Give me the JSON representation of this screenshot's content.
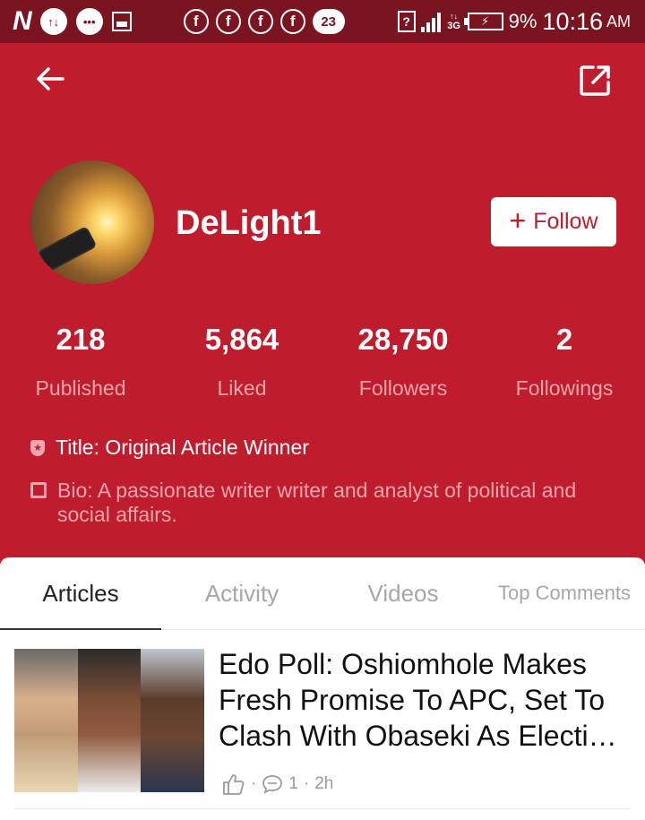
{
  "status_bar": {
    "carrier_letter": "N",
    "notification_badge_count": "23",
    "network_type": "3G",
    "battery_percent": "9%",
    "time": "10:16",
    "ampm": "AM"
  },
  "profile": {
    "username": "DeLight1",
    "follow_label": "Follow",
    "stats": [
      {
        "value": "218",
        "label": "Published"
      },
      {
        "value": "5,864",
        "label": "Liked"
      },
      {
        "value": "28,750",
        "label": "Followers"
      },
      {
        "value": "2",
        "label": "Followings"
      }
    ],
    "title": "Title: Original Article Winner",
    "bio": "Bio: A passionate writer writer and analyst of political and social affairs."
  },
  "tabs": [
    {
      "label": "Articles",
      "active": true
    },
    {
      "label": "Activity",
      "active": false
    },
    {
      "label": "Videos",
      "active": false
    },
    {
      "label": "Top Comments",
      "active": false
    }
  ],
  "articles": [
    {
      "title": "Edo Poll: Oshiomhole Makes Fresh Promise To APC, Set To Clash With Obaseki As Electi…",
      "comment_count": "1",
      "age": "2h"
    }
  ],
  "colors": {
    "status_bar": "#7a1420",
    "header": "#bf1d2e",
    "muted_label": "#f1a5ae"
  }
}
